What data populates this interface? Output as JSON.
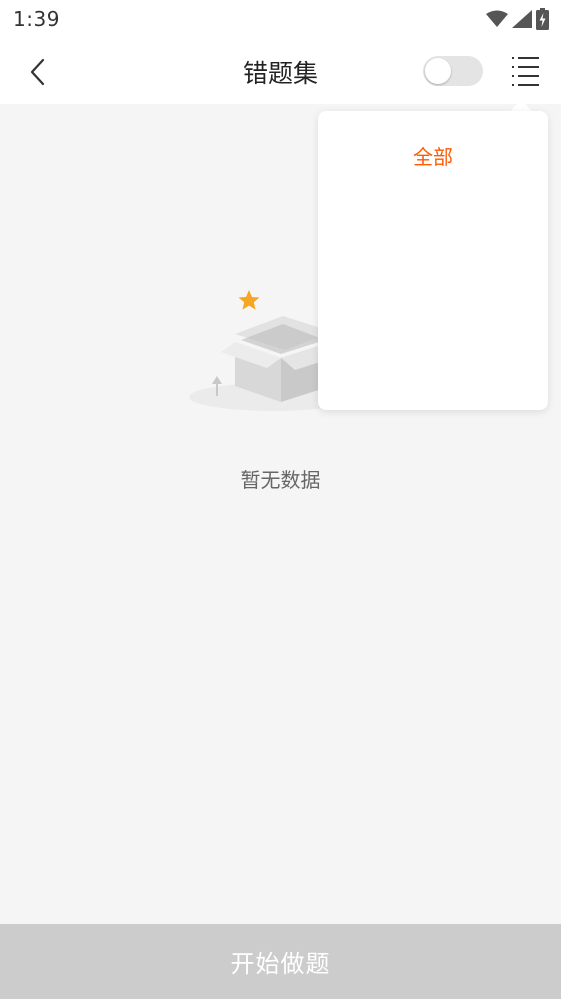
{
  "status_bar": {
    "time": "1:39",
    "icons": [
      "wifi-icon",
      "signal-icon",
      "battery-charging-icon"
    ]
  },
  "header": {
    "back_icon": "chevron-left-icon",
    "title": "错题集",
    "toggle_on": false,
    "menu_icon": "list-menu-icon"
  },
  "empty_state": {
    "illustration": "empty-box-illustration",
    "text": "暂无数据"
  },
  "popup_menu": {
    "items": [
      {
        "label": "全部",
        "selected": true
      }
    ]
  },
  "bottom": {
    "start_label": "开始做题"
  },
  "colors": {
    "accent": "#ff5a00",
    "star": "#f5a623",
    "disabled_button": "#cccccc",
    "background": "#f5f5f5"
  }
}
